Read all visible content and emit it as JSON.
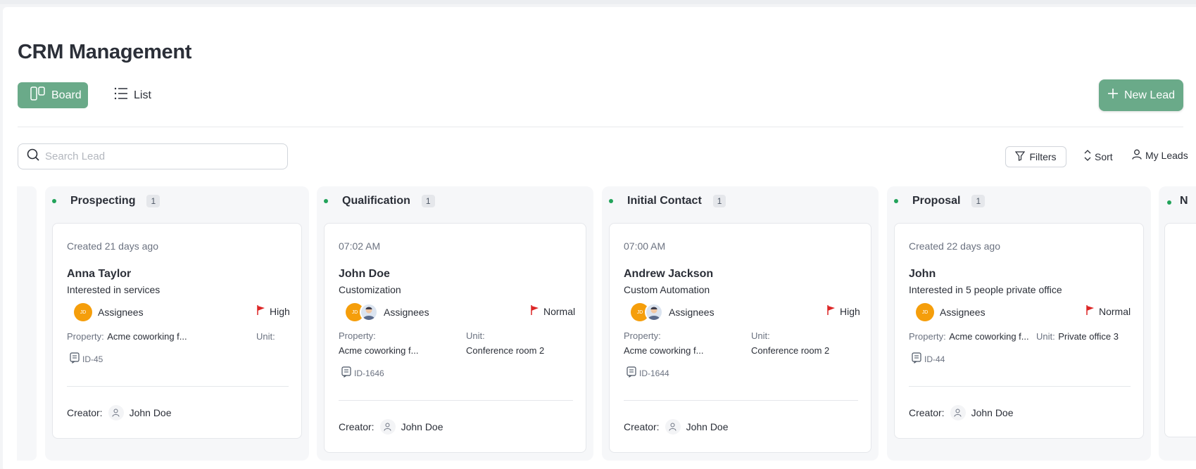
{
  "header": {
    "title": "CRM Management"
  },
  "views": {
    "board_label": "Board",
    "list_label": "List"
  },
  "actions": {
    "new_lead_label": "New Lead"
  },
  "toolbar": {
    "search_placeholder": "Search Lead",
    "filters_label": "Filters",
    "sort_label": "Sort",
    "my_leads_label": "My Leads"
  },
  "colors": {
    "accent": "#6aaa89",
    "status_dot": "#22a35a",
    "flag_red": "#dc2626",
    "avatar_orange": "#f59e0b"
  },
  "columns": [
    {
      "title": "Prospecting",
      "count": "1",
      "card": {
        "date": "Created 21 days ago",
        "name": "Anna Taylor",
        "desc": "Interested in services",
        "assignees_label": "Assignees",
        "avatar_initials": "JD",
        "priority": "High",
        "property_label": "Property:",
        "property_value": "Acme coworking f...",
        "unit_label": "Unit:",
        "unit_value": "",
        "id": "ID-45",
        "creator_label": "Creator:",
        "creator_name": "John Doe"
      }
    },
    {
      "title": "Qualification",
      "count": "1",
      "card": {
        "date": "07:02 AM",
        "name": "John Doe",
        "desc": "Customization",
        "assignees_label": "Assignees",
        "avatar_initials": "JD",
        "priority": "Normal",
        "property_label": "Property:",
        "property_value": "Acme coworking f...",
        "unit_label": "Unit:",
        "unit_value": "Conference room 2",
        "id": "ID-1646",
        "creator_label": "Creator:",
        "creator_name": "John Doe"
      }
    },
    {
      "title": "Initial Contact",
      "count": "1",
      "card": {
        "date": "07:00 AM",
        "name": "Andrew Jackson",
        "desc": "Custom Automation",
        "assignees_label": "Assignees",
        "avatar_initials": "JD",
        "priority": "High",
        "property_label": "Property:",
        "property_value": "Acme coworking f...",
        "unit_label": "Unit:",
        "unit_value": "Conference room 2",
        "id": "ID-1644",
        "creator_label": "Creator:",
        "creator_name": "John Doe"
      }
    },
    {
      "title": "Proposal",
      "count": "1",
      "card": {
        "date": "Created 22 days ago",
        "name": "John",
        "desc": "Interested in 5 people private office",
        "assignees_label": "Assignees",
        "avatar_initials": "JD",
        "priority": "Normal",
        "property_label": "Property:",
        "property_value": "Acme coworking f...",
        "unit_label": "Unit:",
        "unit_value": "Private office 3",
        "id": "ID-44",
        "creator_label": "Creator:",
        "creator_name": "John Doe"
      }
    }
  ],
  "next_column_partial": "N"
}
